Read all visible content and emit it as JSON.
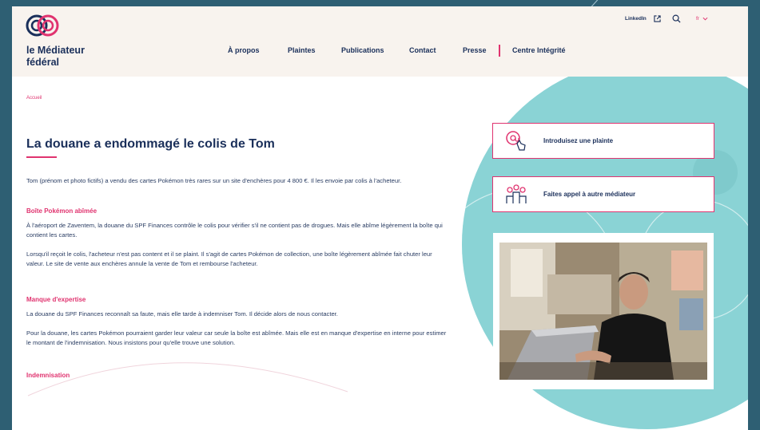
{
  "logo": {
    "name_line1": "le Médiateur",
    "name_line2": "fédéral"
  },
  "nav": {
    "items": [
      "À propos",
      "Plaintes",
      "Publications",
      "Contact",
      "Presse"
    ],
    "integrity": "Centre Intégrité"
  },
  "utility": {
    "linkedin": "LinkedIn",
    "lang": "fr"
  },
  "breadcrumb": "Accueil",
  "article": {
    "title": "La douane a endommagé le colis de Tom",
    "intro": "Tom (prénom et photo fictifs) a vendu des cartes Pokémon très rares sur un site d'enchères pour 4 800 €. Il les envoie par colis à l'acheteur.",
    "sections": [
      {
        "heading": "Boîte Pokémon abîmée",
        "paragraphs": [
          "À l'aéroport de Zaventem, la douane du SPF Finances contrôle le colis pour vérifier s'il ne contient pas de drogues. Mais elle abîme légèrement la boîte qui contient les cartes.",
          "Lorsqu'il reçoit le colis, l'acheteur n'est pas content et il se plaint. Il s'agit de cartes Pokémon de collection, une boîte légèrement abîmée fait chuter leur valeur. Le site de vente aux enchères annule la vente de Tom et rembourse l'acheteur."
        ]
      },
      {
        "heading": "Manque d'expertise",
        "paragraphs": [
          "La douane du SPF Finances reconnaît sa faute, mais elle tarde à indemniser Tom. Il décide alors de nous contacter.",
          "Pour la douane, les cartes Pokémon pourraient garder leur valeur car seule la boîte est abîmée. Mais elle est en manque d'expertise en interne pour estimer le montant de l'indemnisation. Nous insistons pour qu'elle trouve une solution."
        ]
      },
      {
        "heading": "Indemnisation",
        "paragraphs": []
      }
    ]
  },
  "sidebar": {
    "card1": "Introduisez une plainte",
    "card2": "Faites appel à autre médiateur"
  },
  "colors": {
    "accent": "#e0336f",
    "navy": "#1a2f5a",
    "teal": "#7fcdd0",
    "background": "#2e5f73"
  }
}
